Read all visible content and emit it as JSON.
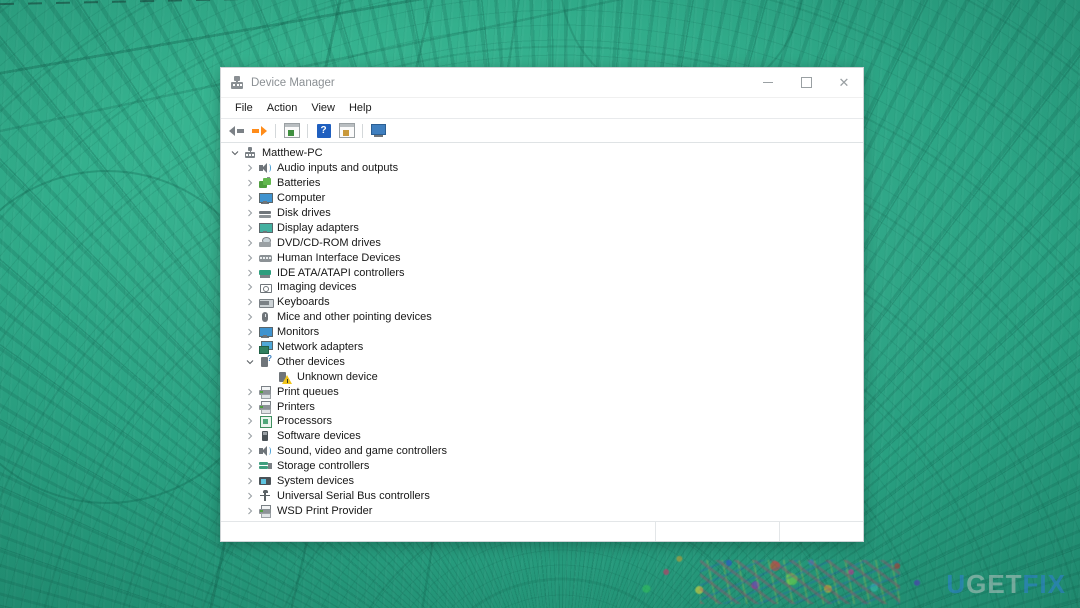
{
  "window": {
    "title": "Device Manager",
    "app_icon": "mmc-console-icon",
    "controls": {
      "minimize": "minimize-button",
      "maximize": "maximize-button",
      "close": "close-button"
    }
  },
  "menubar": {
    "items": [
      {
        "label": "File"
      },
      {
        "label": "Action"
      },
      {
        "label": "View"
      },
      {
        "label": "Help"
      }
    ]
  },
  "toolbar": {
    "buttons": [
      {
        "name": "back-button",
        "icon": "back-arrow-icon",
        "tooltip": "Back"
      },
      {
        "name": "forward-button",
        "icon": "forward-arrow-icon",
        "tooltip": "Forward"
      },
      {
        "name": "properties-button",
        "icon": "properties-icon",
        "tooltip": "Properties"
      },
      {
        "name": "help-button",
        "icon": "help-question-icon",
        "tooltip": "Help"
      },
      {
        "name": "update-driver-button",
        "icon": "update-driver-icon",
        "tooltip": "Update Driver Software"
      },
      {
        "name": "scan-hardware-button",
        "icon": "scan-for-hardware-changes-icon",
        "tooltip": "Scan for hardware changes"
      }
    ]
  },
  "tree": {
    "root": {
      "label": "Matthew-PC",
      "icon": "computer-root-icon",
      "expanded": true,
      "twisty": "chevron-down-icon"
    },
    "nodes": [
      {
        "label": "Audio inputs and outputs",
        "icon": "audio-icon",
        "expanded": false,
        "twisty": "chevron-right-icon",
        "level": 1
      },
      {
        "label": "Batteries",
        "icon": "battery-icon",
        "expanded": false,
        "twisty": "chevron-right-icon",
        "level": 1
      },
      {
        "label": "Computer",
        "icon": "computer-icon",
        "expanded": false,
        "twisty": "chevron-right-icon",
        "level": 1
      },
      {
        "label": "Disk drives",
        "icon": "disk-drive-icon",
        "expanded": false,
        "twisty": "chevron-right-icon",
        "level": 1
      },
      {
        "label": "Display adapters",
        "icon": "display-adapter-icon",
        "expanded": false,
        "twisty": "chevron-right-icon",
        "level": 1
      },
      {
        "label": "DVD/CD-ROM drives",
        "icon": "dvd-drive-icon",
        "expanded": false,
        "twisty": "chevron-right-icon",
        "level": 1
      },
      {
        "label": "Human Interface Devices",
        "icon": "hid-icon",
        "expanded": false,
        "twisty": "chevron-right-icon",
        "level": 1
      },
      {
        "label": "IDE ATA/ATAPI controllers",
        "icon": "ide-controller-icon",
        "expanded": false,
        "twisty": "chevron-right-icon",
        "level": 1
      },
      {
        "label": "Imaging devices",
        "icon": "imaging-device-icon",
        "expanded": false,
        "twisty": "chevron-right-icon",
        "level": 1
      },
      {
        "label": "Keyboards",
        "icon": "keyboard-icon",
        "expanded": false,
        "twisty": "chevron-right-icon",
        "level": 1
      },
      {
        "label": "Mice and other pointing devices",
        "icon": "mouse-icon",
        "expanded": false,
        "twisty": "chevron-right-icon",
        "level": 1
      },
      {
        "label": "Monitors",
        "icon": "monitor-icon",
        "expanded": false,
        "twisty": "chevron-right-icon",
        "level": 1
      },
      {
        "label": "Network adapters",
        "icon": "network-adapter-icon",
        "expanded": false,
        "twisty": "chevron-right-icon",
        "level": 1
      },
      {
        "label": "Other devices",
        "icon": "other-device-icon",
        "expanded": true,
        "twisty": "chevron-down-icon",
        "level": 1
      },
      {
        "label": "Unknown device",
        "icon": "unknown-device-warning-icon",
        "expanded": false,
        "twisty": "none",
        "level": 2
      },
      {
        "label": "Print queues",
        "icon": "print-queue-icon",
        "expanded": false,
        "twisty": "chevron-right-icon",
        "level": 1
      },
      {
        "label": "Printers",
        "icon": "printer-icon",
        "expanded": false,
        "twisty": "chevron-right-icon",
        "level": 1
      },
      {
        "label": "Processors",
        "icon": "processor-icon",
        "expanded": false,
        "twisty": "chevron-right-icon",
        "level": 1
      },
      {
        "label": "Software devices",
        "icon": "software-device-icon",
        "expanded": false,
        "twisty": "chevron-right-icon",
        "level": 1
      },
      {
        "label": "Sound, video and game controllers",
        "icon": "sound-controller-icon",
        "expanded": false,
        "twisty": "chevron-right-icon",
        "level": 1
      },
      {
        "label": "Storage controllers",
        "icon": "storage-controller-icon",
        "expanded": false,
        "twisty": "chevron-right-icon",
        "level": 1
      },
      {
        "label": "System devices",
        "icon": "system-device-icon",
        "expanded": false,
        "twisty": "chevron-right-icon",
        "level": 1
      },
      {
        "label": "Universal Serial Bus controllers",
        "icon": "usb-controller-icon",
        "expanded": false,
        "twisty": "chevron-right-icon",
        "level": 1
      },
      {
        "label": "WSD Print Provider",
        "icon": "wsd-print-provider-icon",
        "expanded": false,
        "twisty": "chevron-right-icon",
        "level": 1
      }
    ]
  },
  "statusbar": {
    "main": "",
    "pane2": "",
    "pane3": ""
  },
  "watermark": {
    "part1": "U",
    "part2": "GET",
    "part3": "FIX"
  },
  "colors": {
    "desktop_teal": "#2aa481",
    "window_bg": "#ffffff",
    "title_text": "#8b9094",
    "accent_blue": "#1f5fbf",
    "warning_yellow": "#f0c419",
    "forward_arrow_orange": "#ff8c1a",
    "watermark_blue": "#2f7fd6"
  }
}
